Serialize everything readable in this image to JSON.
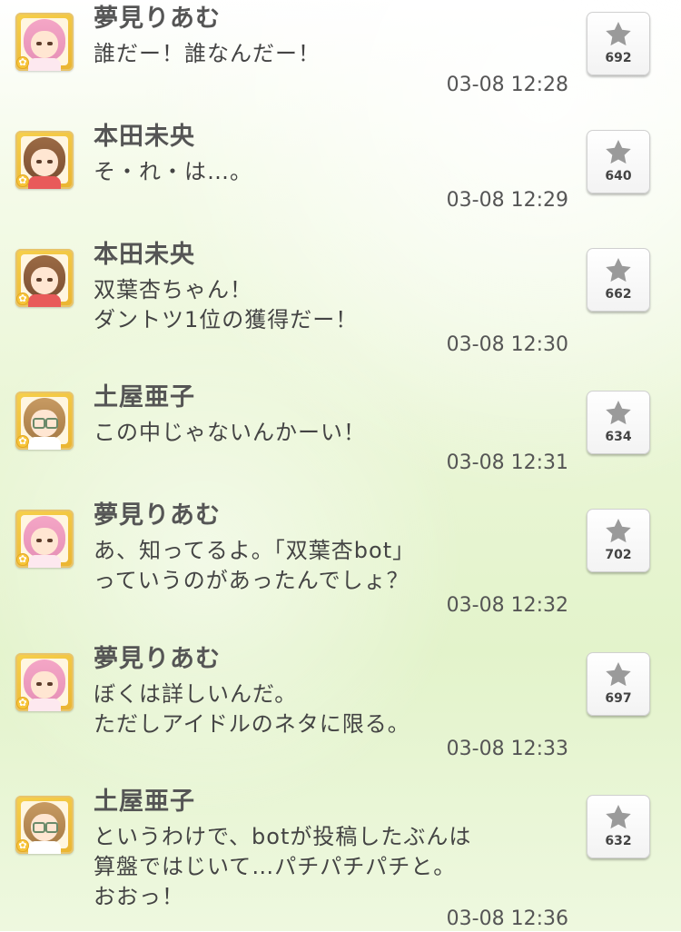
{
  "icon": "star-icon",
  "posts": [
    {
      "avatar": "idol-avatar",
      "name": "夢見りあむ",
      "message": "誰だー！誰なんだー！",
      "time": "03-08 12:28",
      "likes": "692"
    },
    {
      "avatar": "idol-avatar",
      "name": "本田未央",
      "message": "そ・れ・は…。",
      "time": "03-08 12:29",
      "likes": "640"
    },
    {
      "avatar": "idol-avatar",
      "name": "本田未央",
      "message": "双葉杏ちゃん！\nダントツ1位の獲得だー！",
      "time": "03-08 12:30",
      "likes": "662"
    },
    {
      "avatar": "idol-avatar",
      "name": "土屋亜子",
      "message": "この中じゃないんかーい！",
      "time": "03-08 12:31",
      "likes": "634"
    },
    {
      "avatar": "idol-avatar",
      "name": "夢見りあむ",
      "message": "あ、知ってるよ。「双葉杏bot」\nっていうのがあったんでしょ？",
      "time": "03-08 12:32",
      "likes": "702"
    },
    {
      "avatar": "idol-avatar",
      "name": "夢見りあむ",
      "message": "ぼくは詳しいんだ。\nただしアイドルのネタに限る。",
      "time": "03-08 12:33",
      "likes": "697"
    },
    {
      "avatar": "idol-avatar",
      "name": "土屋亜子",
      "message": "というわけで、botが投稿したぶんは\n算盤ではじいて…パチパチパチと。\nおおっ！",
      "time": "03-08 12:36",
      "likes": "632"
    }
  ]
}
